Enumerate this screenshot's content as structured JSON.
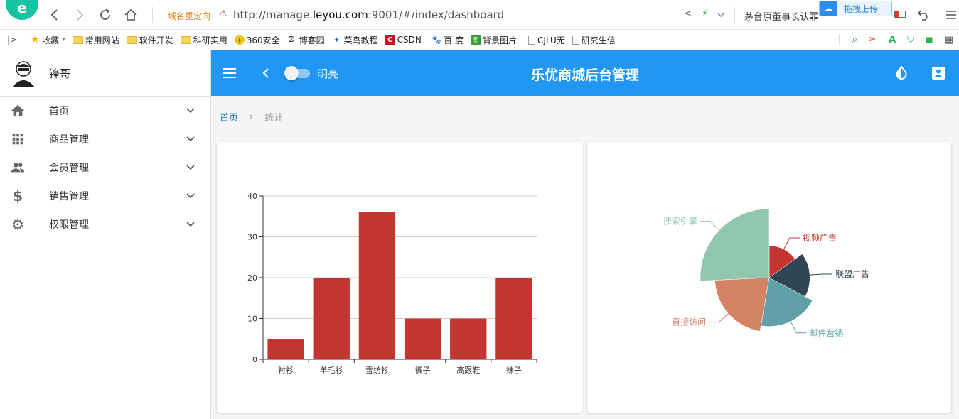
{
  "browser": {
    "url_prefix": "http://manage.",
    "url_host": "leyou.com",
    "url_suffix": ":9001/#/index/dashboard",
    "redirect_label": "域名重定向",
    "news_text": "茅台原董事长认罪",
    "upload_label": "拖拽上传"
  },
  "bookmarks": [
    {
      "label": "收藏",
      "icon": "star-icon"
    },
    {
      "label": "常用网站",
      "icon": "folder-icon"
    },
    {
      "label": "软件开发",
      "icon": "folder-icon"
    },
    {
      "label": "科研实用",
      "icon": "folder-icon"
    },
    {
      "label": "360安全",
      "icon": "360-icon"
    },
    {
      "label": "博客园",
      "icon": "blog-icon"
    },
    {
      "label": "菜鸟教程",
      "icon": "runoob-icon"
    },
    {
      "label": "CSDN-",
      "icon": "csdn-icon"
    },
    {
      "label": "百 度",
      "icon": "baidu-icon"
    },
    {
      "label": "背景图片_",
      "icon": "image-icon"
    },
    {
      "label": "CJLU无",
      "icon": "page-icon"
    },
    {
      "label": "研究生信",
      "icon": "page-icon"
    }
  ],
  "user": {
    "name": "锋哥"
  },
  "nav": [
    {
      "label": "首页",
      "icon": "home-icon"
    },
    {
      "label": "商品管理",
      "icon": "apps-icon"
    },
    {
      "label": "会员管理",
      "icon": "people-icon"
    },
    {
      "label": "销售管理",
      "icon": "dollar-icon"
    },
    {
      "label": "权限管理",
      "icon": "gear-icon"
    }
  ],
  "appbar": {
    "title": "乐优商城后台管理",
    "theme_label": "明亮"
  },
  "breadcrumb": {
    "home": "首页",
    "current": "统计"
  },
  "colors": {
    "primary": "#2196f3",
    "bar": "#c23531",
    "pie": [
      "#c23531",
      "#2f4554",
      "#61a0a8",
      "#d48265",
      "#91c7ae"
    ]
  },
  "chart_data": [
    {
      "type": "bar",
      "categories": [
        "衬衫",
        "羊毛衫",
        "雪纺衫",
        "裤子",
        "高跟鞋",
        "袜子"
      ],
      "values": [
        5,
        20,
        36,
        10,
        10,
        20
      ],
      "ylim": [
        0,
        40
      ],
      "yticks": [
        0,
        10,
        20,
        30,
        40
      ],
      "grid": true
    },
    {
      "type": "pie",
      "labels": [
        "视频广告",
        "联盟广告",
        "邮件营销",
        "直接访问",
        "搜索引擎"
      ],
      "values": [
        235,
        274,
        310,
        335,
        400
      ],
      "rose": "radius"
    }
  ]
}
